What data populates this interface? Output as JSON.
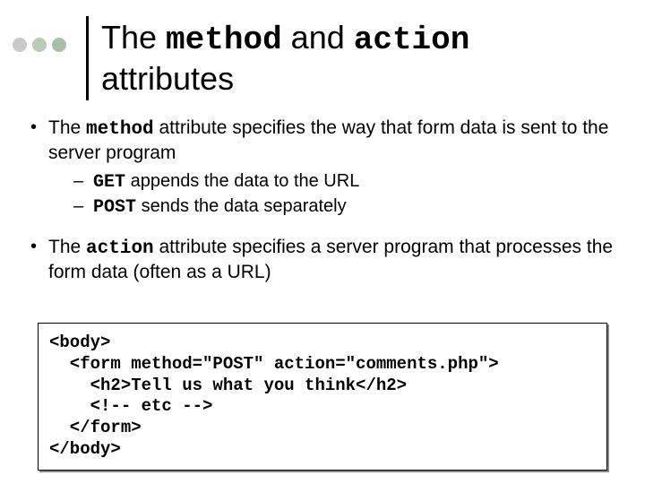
{
  "title": {
    "prefix": "The ",
    "code1": "method",
    "mid": " and ",
    "code2": "action",
    "line2": "attributes"
  },
  "bullets": {
    "b1_prefix": "The ",
    "b1_code": "method",
    "b1_rest": " attribute specifies the way that form data is sent to the server program",
    "b1_sub1_code": "GET",
    "b1_sub1_rest": " appends the data to the URL",
    "b1_sub2_code": "POST",
    "b1_sub2_rest": " sends the data separately",
    "b2_prefix": "The ",
    "b2_code": "action",
    "b2_rest": " attribute specifies a server program that processes the form data (often as a URL)"
  },
  "code": {
    "l1": "<body>",
    "l2": "  <form method=\"POST\" action=\"comments.php\">",
    "l3": "    <h2>Tell us what you think</h2>",
    "l4": "    <!-- etc -->",
    "l5": "  </form>",
    "l6": "</body>"
  }
}
